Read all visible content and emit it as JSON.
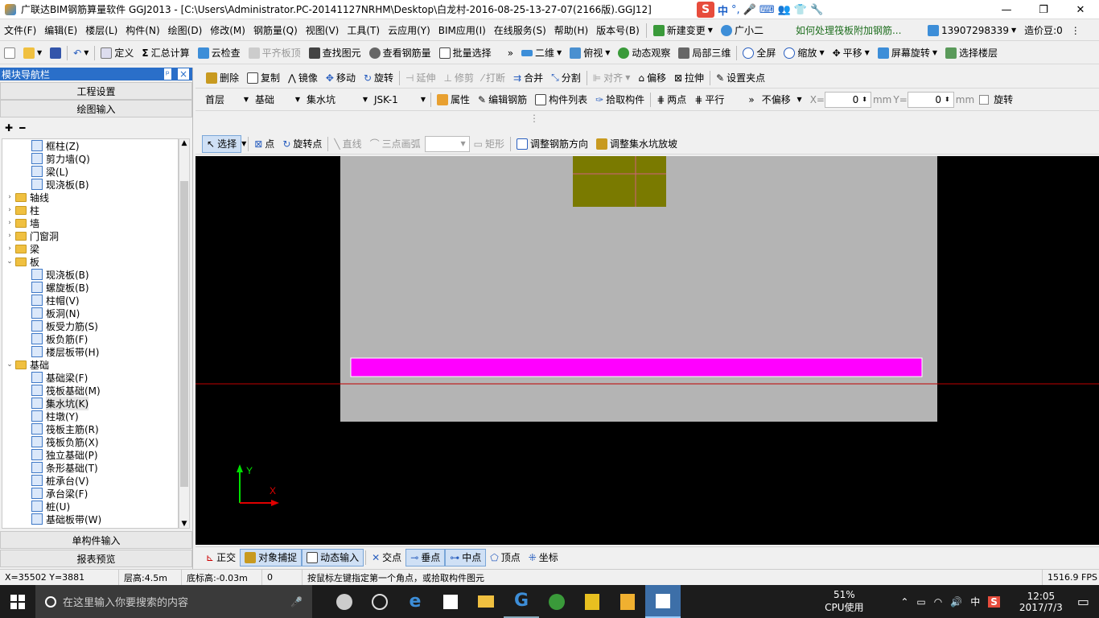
{
  "window": {
    "title": "广联达BIM钢筋算量软件 GGJ2013 - [C:\\Users\\Administrator.PC-20141127NRHM\\Desktop\\白龙村-2016-08-25-13-27-07(2166版).GGJ12]",
    "ime": {
      "lang": "中",
      "punct": "°,"
    },
    "min": "—",
    "max": "❐",
    "close": "✕"
  },
  "menu": {
    "items": [
      "文件(F)",
      "编辑(E)",
      "楼层(L)",
      "构件(N)",
      "绘图(D)",
      "修改(M)",
      "钢筋量(Q)",
      "视图(V)",
      "工具(T)",
      "云应用(Y)",
      "BIM应用(I)",
      "在线服务(S)",
      "帮助(H)",
      "版本号(B)"
    ],
    "new_change": "新建变更",
    "assistant": "广小二",
    "question": "如何处理筏板附加钢筋...",
    "phone": "13907298339",
    "beans": "造价豆:0"
  },
  "toolbar1": {
    "define": "定义",
    "sum": "汇总计算",
    "cloud_check": "云检查",
    "flat_top": "平齐板顶",
    "find": "查找图元",
    "view_rebar": "查看钢筋量",
    "batch_select": "批量选择",
    "view2d": "二维",
    "view_dir": "俯视",
    "dyn_obs": "动态观察",
    "local3d": "局部三维",
    "full": "全屏",
    "zoom": "缩放",
    "pan": "平移",
    "rotate": "屏幕旋转",
    "sel_floor": "选择楼层"
  },
  "toolbar2": {
    "delete": "删除",
    "copy": "复制",
    "mirror": "镜像",
    "move": "移动",
    "rotate": "旋转",
    "extend": "延伸",
    "trim": "修剪",
    "break": "打断",
    "merge": "合并",
    "split": "分割",
    "align": "对齐",
    "offset": "偏移",
    "stretch": "拉伸",
    "set_point": "设置夹点"
  },
  "toolbar3": {
    "floor": "首层",
    "category": "基础",
    "type": "集水坑",
    "name": "JSK-1",
    "prop": "属性",
    "edit_rebar": "编辑钢筋",
    "comp_list": "构件列表",
    "pick": "拾取构件",
    "two_point": "两点",
    "parallel": "平行",
    "offset_mode": "不偏移",
    "x_label": "X=",
    "x_val": "0",
    "y_label": "Y=",
    "y_val": "0",
    "unit": "mm",
    "rotate": "旋转"
  },
  "toolbar4": {
    "select": "选择",
    "point": "点",
    "rot_point": "旋转点",
    "line": "直线",
    "arc": "三点画弧",
    "rect": "矩形",
    "adj_rebar": "调整钢筋方向",
    "adj_slope": "调整集水坑放坡"
  },
  "panel": {
    "title": "模块导航栏",
    "pin": "ᵖ",
    "close": "×",
    "project_settings": "工程设置",
    "drawing_input": "绘图输入",
    "single_input": "单构件输入",
    "report": "报表预览",
    "tree": [
      {
        "label": "框柱(Z)",
        "indent": 2,
        "type": "item"
      },
      {
        "label": "剪力墙(Q)",
        "indent": 2,
        "type": "item"
      },
      {
        "label": "梁(L)",
        "indent": 2,
        "type": "item"
      },
      {
        "label": "现浇板(B)",
        "indent": 2,
        "type": "item"
      },
      {
        "label": "轴线",
        "indent": 0,
        "type": "folder",
        "tog": "›"
      },
      {
        "label": "柱",
        "indent": 0,
        "type": "folder",
        "tog": "›"
      },
      {
        "label": "墙",
        "indent": 0,
        "type": "folder",
        "tog": "›"
      },
      {
        "label": "门窗洞",
        "indent": 0,
        "type": "folder",
        "tog": "›"
      },
      {
        "label": "梁",
        "indent": 0,
        "type": "folder",
        "tog": "›"
      },
      {
        "label": "板",
        "indent": 0,
        "type": "folder",
        "tog": "⌄"
      },
      {
        "label": "现浇板(B)",
        "indent": 2,
        "type": "item"
      },
      {
        "label": "螺旋板(B)",
        "indent": 2,
        "type": "item"
      },
      {
        "label": "柱帽(V)",
        "indent": 2,
        "type": "item"
      },
      {
        "label": "板洞(N)",
        "indent": 2,
        "type": "item"
      },
      {
        "label": "板受力筋(S)",
        "indent": 2,
        "type": "item"
      },
      {
        "label": "板负筋(F)",
        "indent": 2,
        "type": "item"
      },
      {
        "label": "楼层板带(H)",
        "indent": 2,
        "type": "item"
      },
      {
        "label": "基础",
        "indent": 0,
        "type": "folder",
        "tog": "⌄"
      },
      {
        "label": "基础梁(F)",
        "indent": 2,
        "type": "item"
      },
      {
        "label": "筏板基础(M)",
        "indent": 2,
        "type": "item"
      },
      {
        "label": "集水坑(K)",
        "indent": 2,
        "type": "item",
        "selected": true
      },
      {
        "label": "柱墩(Y)",
        "indent": 2,
        "type": "item"
      },
      {
        "label": "筏板主筋(R)",
        "indent": 2,
        "type": "item"
      },
      {
        "label": "筏板负筋(X)",
        "indent": 2,
        "type": "item"
      },
      {
        "label": "独立基础(P)",
        "indent": 2,
        "type": "item"
      },
      {
        "label": "条形基础(T)",
        "indent": 2,
        "type": "item"
      },
      {
        "label": "桩承台(V)",
        "indent": 2,
        "type": "item"
      },
      {
        "label": "承台梁(F)",
        "indent": 2,
        "type": "item"
      },
      {
        "label": "桩(U)",
        "indent": 2,
        "type": "item"
      },
      {
        "label": "基础板带(W)",
        "indent": 2,
        "type": "item"
      }
    ]
  },
  "canvas": {
    "axis_x": "X",
    "axis_y": "Y",
    "colors": {
      "bg": "#000000",
      "slab": "#b4b4b4",
      "pit": "#7a7a00",
      "beam": "#ff00ff",
      "line": "#c00000"
    }
  },
  "snapbar": {
    "ortho": "正交",
    "osnap": "对象捕捉",
    "dyn_input": "动态输入",
    "intersect": "交点",
    "perp": "垂点",
    "mid": "中点",
    "vertex": "顶点",
    "coord": "坐标"
  },
  "status": {
    "coords": "X=35502 Y=3881",
    "floor_h": "层高:4.5m",
    "bottom_h": "底标高:-0.03m",
    "zero": "0",
    "hint": "按鼠标左键指定第一个角点，或拾取构件图元",
    "fps": "1516.9 FPS"
  },
  "taskbar": {
    "search_placeholder": "在这里输入你要搜索的内容",
    "cpu_pct": "51%",
    "cpu_label": "CPU使用",
    "ime": "中",
    "time": "12:05",
    "date": "2017/7/3"
  }
}
